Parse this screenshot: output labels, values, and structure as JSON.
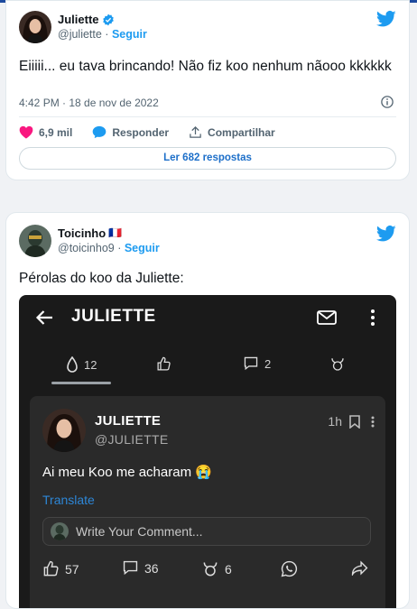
{
  "tweet1": {
    "author_name": "Juliette",
    "handle": "@juliette",
    "follow_label": "Seguir",
    "text": "Eiiiii... eu tava brincando! Não fiz koo nenhum nãooo kkkkkk",
    "timestamp": "4:42 PM · 18 de nov de 2022",
    "likes": "6,9 mil",
    "reply_label": "Responder",
    "share_label": "Compartilhar",
    "read_replies_label": "Ler 682 respostas"
  },
  "tweet2": {
    "author_name": "Toicinho",
    "flag": "🇫🇷",
    "handle": "@toicinho9",
    "follow_label": "Seguir",
    "text": "Pérolas do koo da Juliette:"
  },
  "embedded": {
    "title": "JULIETTE",
    "tabs": {
      "posts_count": "12",
      "comments_count": "2"
    },
    "post": {
      "name": "JULIETTE",
      "handle": "@JULIETTE",
      "time": "1h",
      "text": "Ai meu Koo me acharam 😭",
      "translate_label": "Translate",
      "comment_placeholder": "Write Your Comment...",
      "likes": "57",
      "comments": "36",
      "rekoos": "6"
    }
  },
  "colors": {
    "twitter_blue": "#1d9bf0",
    "heart": "#f91880",
    "link_blue": "#1d6fc9",
    "dark_bg": "#1a1a1a"
  }
}
